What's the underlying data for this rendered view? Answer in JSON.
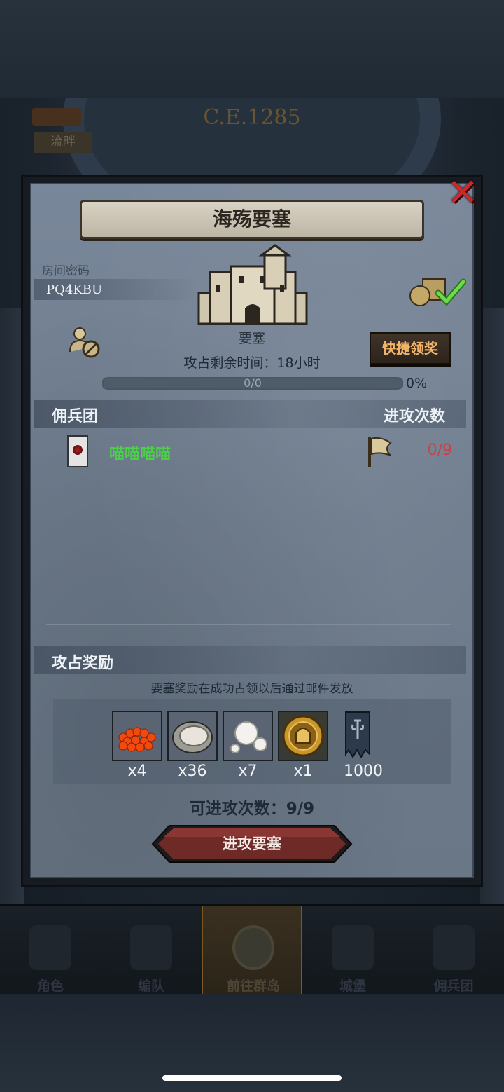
{
  "background": {
    "year": "C.E.1285",
    "left_tab": "流畔"
  },
  "dialog": {
    "title": "海殇要塞",
    "room_code_label": "房间密码",
    "room_code": "PQ4KBU",
    "fortress_label": "要塞",
    "quick_claim_label": "快捷领奖",
    "remaining_time": "攻占剩余时间：18小时",
    "progress": {
      "text": "0/0",
      "percent_label": "0%",
      "value": 0
    },
    "mercenary_section": {
      "title": "佣兵团",
      "attacks_header": "进攻次数",
      "rows": [
        {
          "name": "喵喵喵喵",
          "attacks": "0/9"
        }
      ]
    },
    "rewards_section": {
      "title": "攻占奖励",
      "note": "要塞奖励在成功占领以后通过邮件发放",
      "items": [
        {
          "icon": "roe-icon",
          "count": "x4"
        },
        {
          "icon": "oyster-icon",
          "count": "x36"
        },
        {
          "icon": "pearl-icon",
          "count": "x7"
        },
        {
          "icon": "knight-medal-icon",
          "count": "x1"
        },
        {
          "icon": "banner-icon",
          "count": "1000"
        }
      ]
    },
    "attack_available": "可进攻次数：9/9",
    "attack_button": "进攻要塞"
  },
  "nav": {
    "items": [
      {
        "label": "角色",
        "icon": "knight-icon",
        "active": false
      },
      {
        "label": "编队",
        "icon": "helmet-icon",
        "active": false
      },
      {
        "label": "前往群岛",
        "icon": "globe-icon",
        "active": true
      },
      {
        "label": "城堡",
        "icon": "castle-icon",
        "active": false
      },
      {
        "label": "佣兵团",
        "icon": "ship-icon",
        "active": false
      }
    ]
  },
  "colors": {
    "merc_name": "#4cd04a",
    "attacks_red": "#d04040",
    "quick_claim_text": "#f3b56a",
    "close_red": "#d0262a"
  }
}
